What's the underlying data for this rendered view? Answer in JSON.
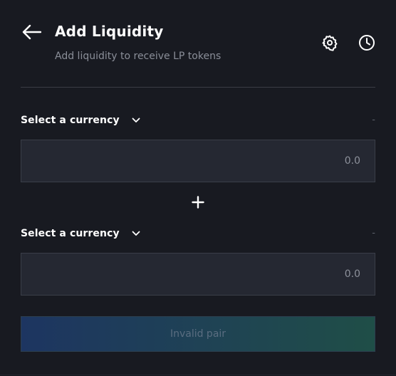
{
  "header": {
    "title": "Add Liquidity",
    "subtitle": "Add liquidity to receive LP tokens"
  },
  "icons": {
    "back": "arrow-left-icon",
    "settings": "gear-icon",
    "history": "clock-icon",
    "dropdown": "chevron-down-icon",
    "plus": "plus-icon"
  },
  "token_a": {
    "select_label": "Select a currency",
    "balance": "-",
    "amount_placeholder": "0.0"
  },
  "token_b": {
    "select_label": "Select a currency",
    "balance": "-",
    "amount_placeholder": "0.0"
  },
  "submit": {
    "label": "Invalid pair"
  },
  "colors": {
    "background": "#181a21",
    "input_bg": "#252832",
    "button_gradient_start": "#1d3561",
    "button_gradient_end": "#1f4e47"
  }
}
